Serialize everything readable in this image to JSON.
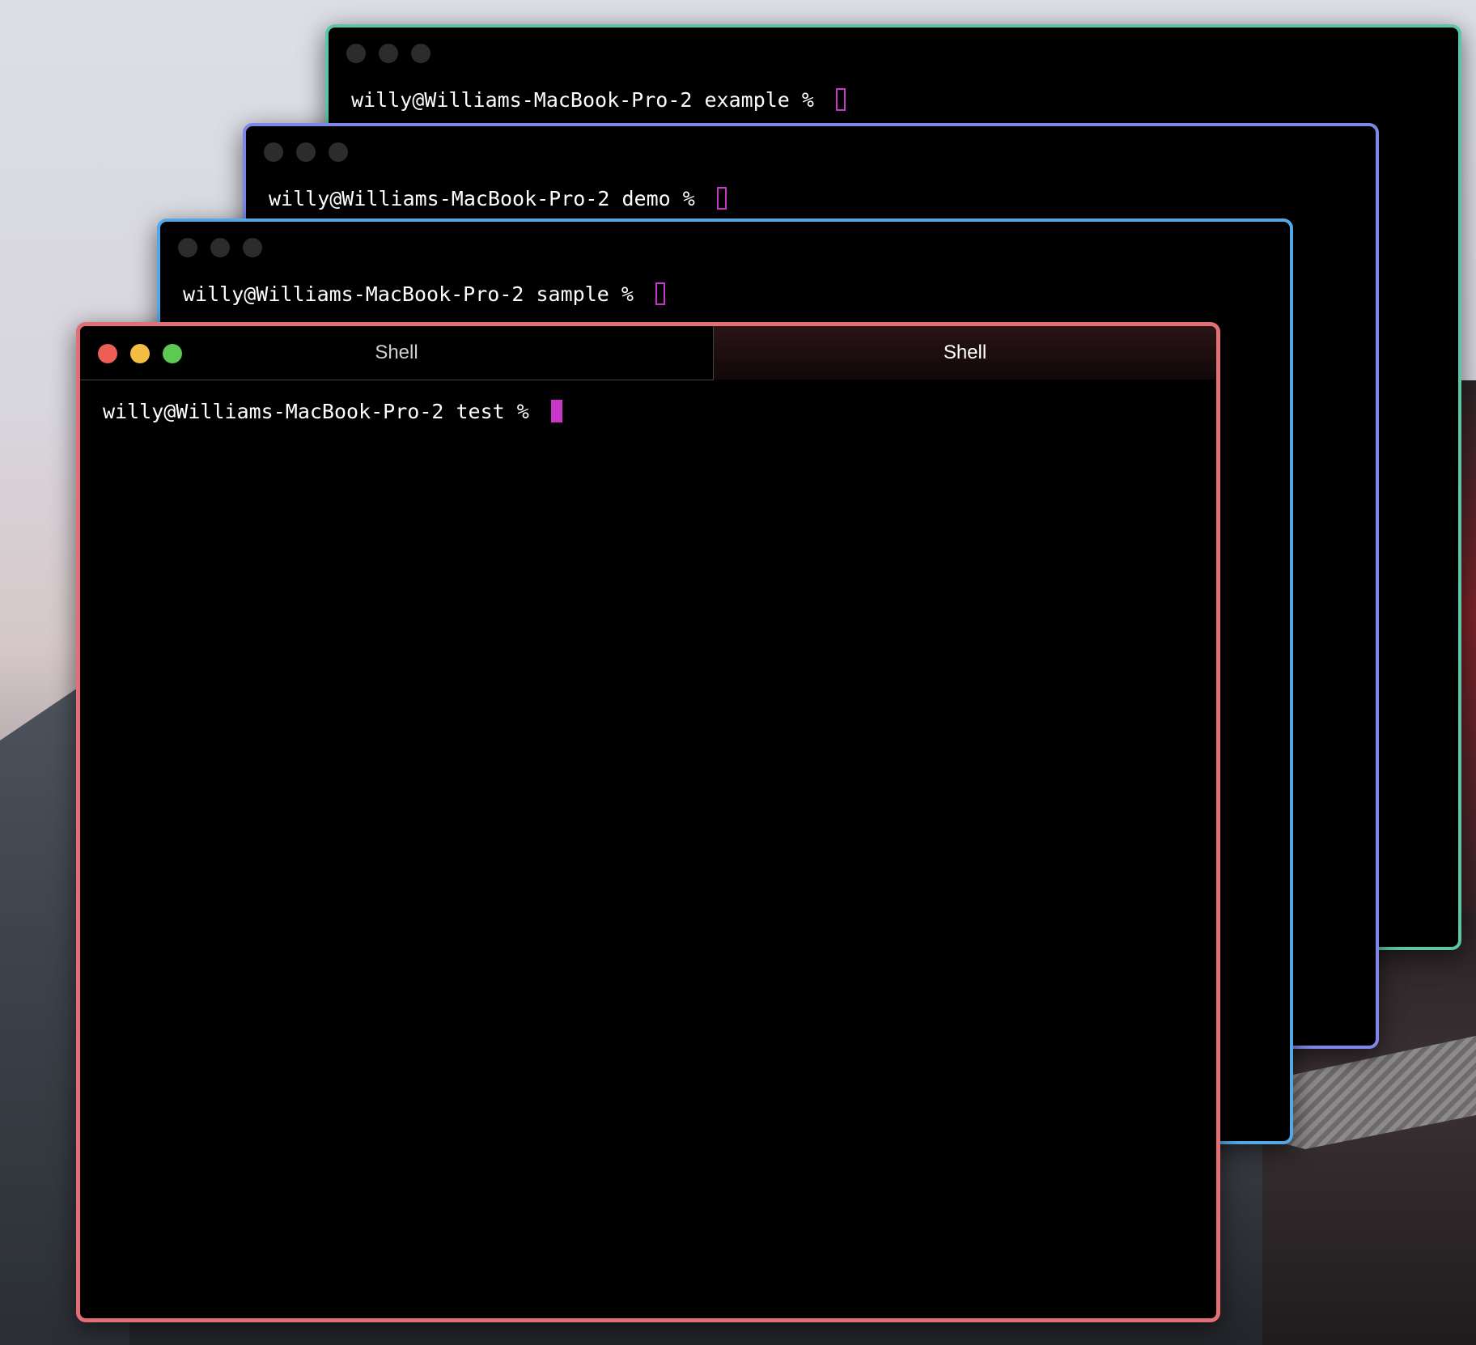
{
  "windows": [
    {
      "prompt": "willy@Williams-MacBook-Pro-2 example % ",
      "border_color": "#5ec4a6"
    },
    {
      "prompt": "willy@Williams-MacBook-Pro-2 demo % ",
      "border_color": "#7f86e8"
    },
    {
      "prompt": "willy@Williams-MacBook-Pro-2 sample % ",
      "border_color": "#55a8e6"
    },
    {
      "prompt": "willy@Williams-MacBook-Pro-2 test % ",
      "border_color": "#e26f74",
      "tabs": [
        {
          "label": "Shell",
          "active": false
        },
        {
          "label": "Shell",
          "active": true
        }
      ]
    }
  ],
  "cursor_color": "#c837c8",
  "icons": {
    "close": "close-icon",
    "minimize": "minimize-icon",
    "zoom": "zoom-icon"
  }
}
